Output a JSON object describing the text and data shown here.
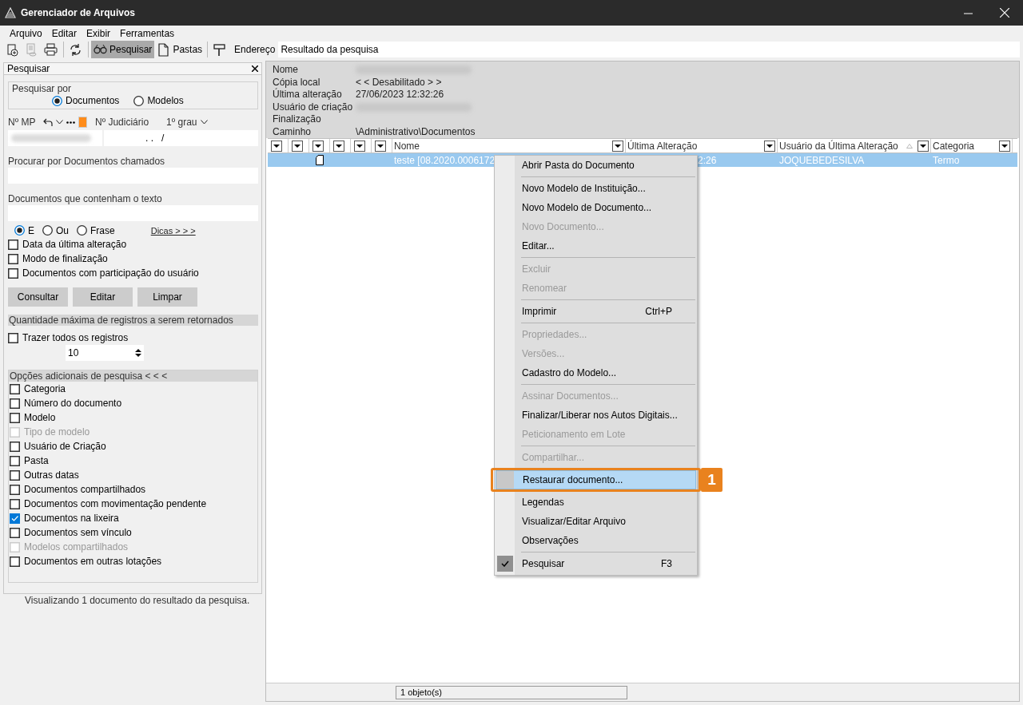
{
  "window": {
    "title": "Gerenciador de Arquivos"
  },
  "menu_bar": [
    "Arquivo",
    "Editar",
    "Exibir",
    "Ferramentas"
  ],
  "toolbar": {
    "icon_buttons": [
      {
        "disabled": false
      },
      {
        "disabled": true
      },
      {
        "disabled": false
      },
      {
        "disabled": false
      }
    ],
    "views": [
      {
        "label": "Pesquisar",
        "selected": true
      },
      {
        "label": "Pastas",
        "selected": false
      }
    ],
    "address_label": "Endereço",
    "address_value": "Resultado da pesquisa"
  },
  "search_panel": {
    "title": "Pesquisar",
    "search_by": {
      "label": "Pesquisar por",
      "options": [
        {
          "label": "Documentos",
          "selected": true
        },
        {
          "label": "Modelos",
          "selected": false
        }
      ]
    },
    "mp_label": "Nº MP",
    "judicial_label": "Nº Judiciário",
    "degree": "1º grau",
    "judicial_value": ". .   /",
    "fields": [
      {
        "label": "Procurar por Documentos chamados"
      },
      {
        "label": "Documentos que contenham o texto"
      }
    ],
    "match_options": [
      {
        "label": "E",
        "selected": true
      },
      {
        "label": "Ou",
        "selected": false
      },
      {
        "label": "Frase",
        "selected": false
      }
    ],
    "tips_link": "Dicas > > >",
    "filters": [
      {
        "label": "Data da última alteração",
        "checked": false
      },
      {
        "label": "Modo de finalização",
        "checked": false
      },
      {
        "label": "Documentos com participação do usuário",
        "checked": false
      }
    ],
    "buttons": [
      "Consultar",
      "Editar",
      "Limpar"
    ],
    "max_section": {
      "title": "Quantidade máxima de registros a serem retornados",
      "checkbox": {
        "label": "Trazer todos os registros",
        "checked": false
      },
      "value": "10"
    },
    "extra_section": {
      "title": "Opções adicionais de pesquisa < < <",
      "options": [
        {
          "label": "Categoria",
          "checked": false,
          "disabled": false
        },
        {
          "label": "Número do documento",
          "checked": false,
          "disabled": false
        },
        {
          "label": "Modelo",
          "checked": false,
          "disabled": false
        },
        {
          "label": "Tipo de modelo",
          "checked": false,
          "disabled": true
        },
        {
          "label": "Usuário de Criação",
          "checked": false,
          "disabled": false
        },
        {
          "label": "Pasta",
          "checked": false,
          "disabled": false
        },
        {
          "label": "Outras datas",
          "checked": false,
          "disabled": false
        },
        {
          "label": "Documentos compartilhados",
          "checked": false,
          "disabled": false
        },
        {
          "label": "Documentos com movimentação pendente",
          "checked": false,
          "disabled": false
        },
        {
          "label": "Documentos na lixeira",
          "checked": true,
          "disabled": false
        },
        {
          "label": "Documentos sem vínculo",
          "checked": false,
          "disabled": false
        },
        {
          "label": "Modelos compartilhados",
          "checked": false,
          "disabled": true
        },
        {
          "label": "Documentos em outras lotações",
          "checked": false,
          "disabled": false
        }
      ]
    },
    "footer": "Visualizando 1 documento do resultado da pesquisa."
  },
  "results": {
    "details": [
      {
        "label": "Nome",
        "kind": "redacted"
      },
      {
        "label": "Cópia local",
        "kind": "text",
        "value": "< < Desabilitado > >"
      },
      {
        "label": "Última alteração",
        "kind": "text",
        "value": "27/06/2023 12:32:26"
      },
      {
        "label": "Usuário de criação",
        "kind": "redacted"
      },
      {
        "label": "Finalização",
        "kind": "empty"
      },
      {
        "label": "Caminho",
        "kind": "text",
        "value": "\\Administrativo\\Documentos"
      }
    ],
    "columns": [
      {
        "kind": "filter"
      },
      {
        "kind": "filter"
      },
      {
        "kind": "filter"
      },
      {
        "kind": "filter"
      },
      {
        "kind": "filter"
      },
      {
        "kind": "filter"
      },
      {
        "kind": "named",
        "label": "Nome",
        "sorted": false
      },
      {
        "kind": "named",
        "label": "Última Alteração",
        "sorted": false
      },
      {
        "kind": "named",
        "label": "Usuário da Última Alteração",
        "sorted": true
      },
      {
        "kind": "named",
        "label": "Categoria",
        "sorted": false
      }
    ],
    "rows": [
      {
        "selected": true,
        "cells": [
          "teste [08.2020.0006172",
          "2:26",
          "JOQUEBEDESILVA",
          "Termo"
        ]
      }
    ],
    "status": "1 objeto(s)"
  },
  "context_menu": [
    {
      "kind": "item",
      "label": "Abrir Pasta do Documento",
      "disabled": false,
      "selected": false,
      "checked": false
    },
    {
      "kind": "separator"
    },
    {
      "kind": "item",
      "label": "Novo Modelo de Instituição...",
      "disabled": false,
      "selected": false,
      "checked": false
    },
    {
      "kind": "item",
      "label": "Novo Modelo de Documento...",
      "disabled": false,
      "selected": false,
      "checked": false
    },
    {
      "kind": "item",
      "label": "Novo Documento...",
      "disabled": true,
      "selected": false,
      "checked": false
    },
    {
      "kind": "item",
      "label": "Editar...",
      "disabled": false,
      "selected": false,
      "checked": false
    },
    {
      "kind": "separator"
    },
    {
      "kind": "item",
      "label": "Excluir",
      "disabled": true,
      "selected": false,
      "checked": false
    },
    {
      "kind": "item",
      "label": "Renomear",
      "disabled": true,
      "selected": false,
      "checked": false
    },
    {
      "kind": "separator"
    },
    {
      "kind": "item",
      "label": "Imprimir",
      "shortcut": "Ctrl+P",
      "disabled": false,
      "selected": false,
      "checked": false
    },
    {
      "kind": "separator"
    },
    {
      "kind": "item",
      "label": "Propriedades...",
      "disabled": true,
      "selected": false,
      "checked": false
    },
    {
      "kind": "item",
      "label": "Versões...",
      "disabled": true,
      "selected": false,
      "checked": false
    },
    {
      "kind": "item",
      "label": "Cadastro do Modelo...",
      "disabled": false,
      "selected": false,
      "checked": false
    },
    {
      "kind": "separator"
    },
    {
      "kind": "item",
      "label": "Assinar Documentos...",
      "disabled": true,
      "selected": false,
      "checked": false
    },
    {
      "kind": "item",
      "label": "Finalizar/Liberar nos Autos Digitais...",
      "disabled": false,
      "selected": false,
      "checked": false
    },
    {
      "kind": "item",
      "label": "Peticionamento em Lote",
      "disabled": true,
      "selected": false,
      "checked": false
    },
    {
      "kind": "separator"
    },
    {
      "kind": "item",
      "label": "Compartilhar...",
      "disabled": true,
      "selected": false,
      "checked": false
    },
    {
      "kind": "item",
      "label": "Restaurar documento...",
      "disabled": false,
      "selected": true,
      "checked": false
    },
    {
      "kind": "item",
      "label": "Legendas",
      "disabled": false,
      "selected": false,
      "checked": false
    },
    {
      "kind": "item",
      "label": "Visualizar/Editar Arquivo",
      "disabled": false,
      "selected": false,
      "checked": false
    },
    {
      "kind": "item",
      "label": "Observações",
      "disabled": false,
      "selected": false,
      "checked": false
    },
    {
      "kind": "separator"
    },
    {
      "kind": "item",
      "label": "Pesquisar",
      "shortcut": "F3",
      "disabled": false,
      "selected": false,
      "checked": true
    }
  ],
  "callout": {
    "label": "1"
  }
}
